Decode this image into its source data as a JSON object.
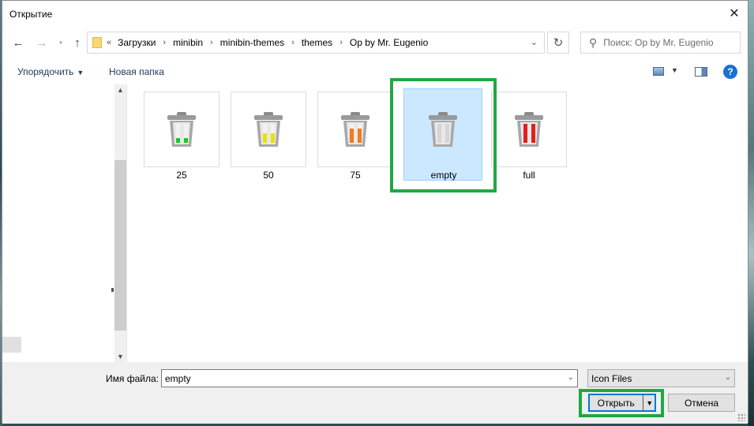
{
  "window": {
    "title": "Открытие"
  },
  "nav": {
    "back_icon": "arrow-left-icon",
    "forward_icon": "arrow-right-icon",
    "recent_icon": "chevron-down-icon",
    "up_icon": "arrow-up-icon"
  },
  "address": {
    "overflow": "«",
    "crumbs": [
      "Загрузки",
      "minibin",
      "minibin-themes",
      "themes",
      "Op by Mr. Eugenio"
    ]
  },
  "search": {
    "placeholder": "Поиск: Op by Mr. Eugenio"
  },
  "toolbar": {
    "organize_label": "Упорядочить",
    "new_folder_label": "Новая папка",
    "help_label": "?"
  },
  "files": [
    {
      "label": "25",
      "bar_color": "#22c41f",
      "fill_level": 0.25
    },
    {
      "label": "50",
      "bar_color": "#e6e20c",
      "fill_level": 0.5
    },
    {
      "label": "75",
      "bar_color": "#f07a22",
      "fill_level": 0.75
    },
    {
      "label": "empty",
      "bar_color": "#bfbfbf",
      "fill_level": 0,
      "selected": true
    },
    {
      "label": "full",
      "bar_color": "#e21f1f",
      "fill_level": 1
    }
  ],
  "footer": {
    "filename_label": "Имя файла:",
    "filename_value": "empty",
    "filter_value": "Icon Files",
    "open_label": "Открыть",
    "cancel_label": "Отмена"
  },
  "colors": {
    "highlight": "#22a745",
    "selection": "#cce8ff",
    "accent": "#0078d7"
  }
}
